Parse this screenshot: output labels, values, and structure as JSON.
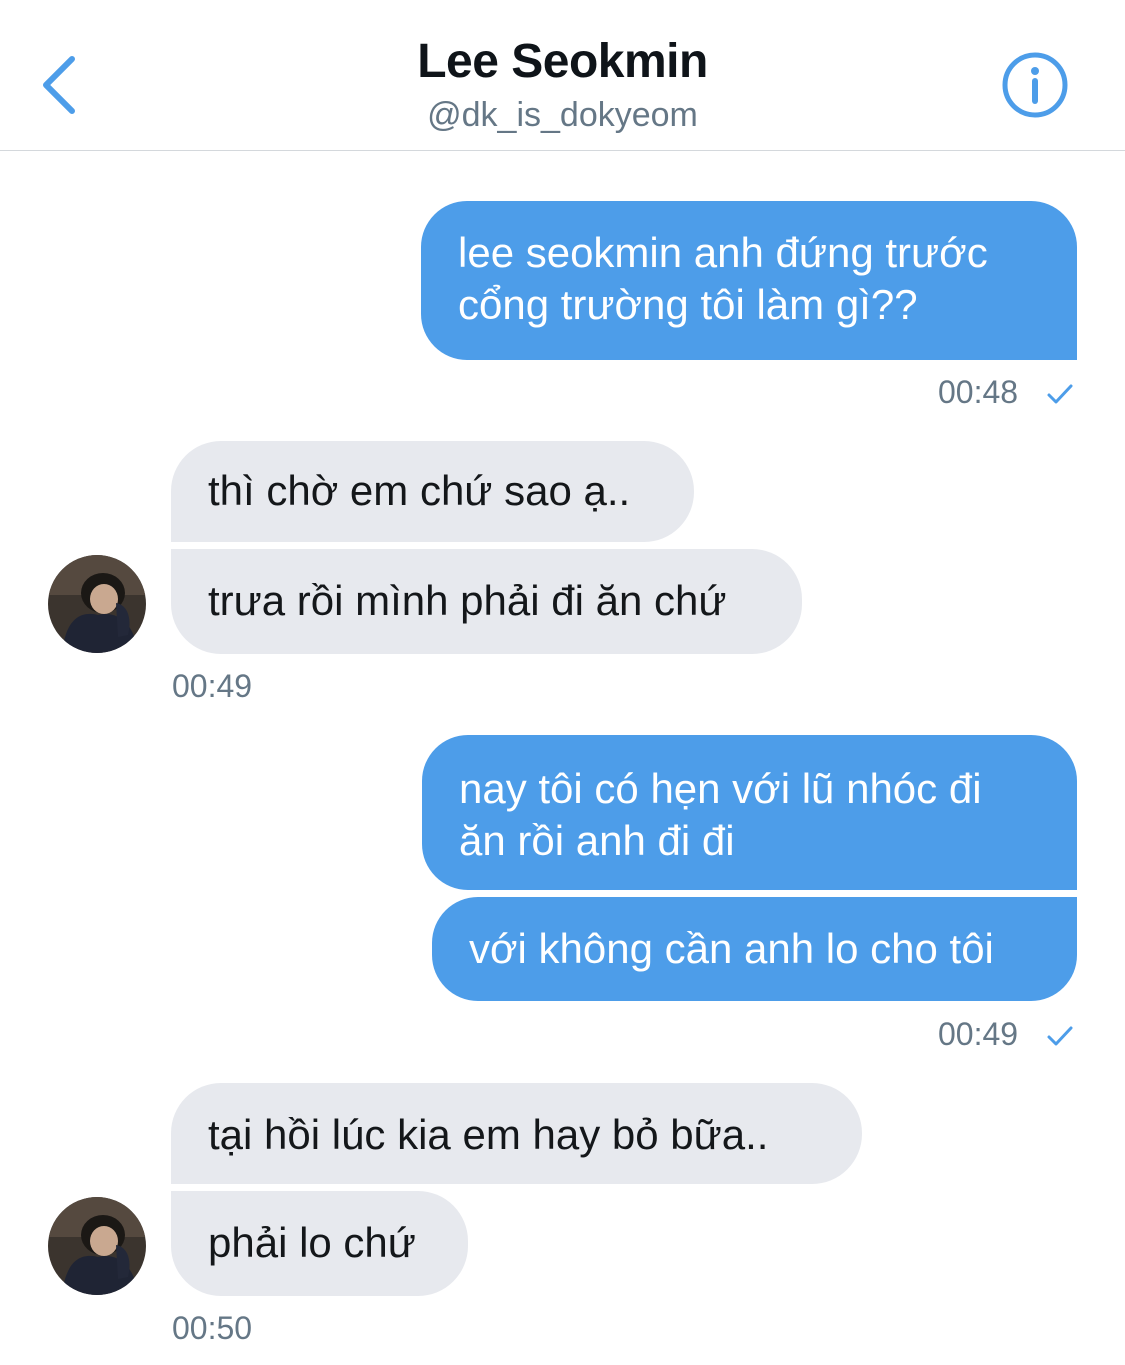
{
  "header": {
    "title": "Lee Seokmin",
    "handle": "@dk_is_dokyeom",
    "back_icon": "chevron-left-icon",
    "info_icon": "info-icon"
  },
  "colors": {
    "accent": "#4d9de9",
    "received_bubble": "#e7e9ee",
    "meta_text": "#657786"
  },
  "messages": [
    {
      "from": "me",
      "lines": [
        "lee seokmin anh đứng trước",
        "cổng trường tôi làm gì??"
      ]
    },
    {
      "from": "me",
      "time": "00:48",
      "status": "sent-check-icon"
    },
    {
      "from": "them",
      "text": "thì chờ em chứ sao ạ.."
    },
    {
      "from": "them",
      "text": "trưa rồi mình phải đi ăn chứ"
    },
    {
      "from": "them",
      "time": "00:49"
    },
    {
      "from": "me",
      "lines": [
        "nay tôi có hẹn với lũ nhóc đi",
        "ăn rồi anh đi đi"
      ]
    },
    {
      "from": "me",
      "text": "với không cần anh lo cho tôi"
    },
    {
      "from": "me",
      "time": "00:49",
      "status": "sent-check-icon"
    },
    {
      "from": "them",
      "text": "tại hồi lúc kia em hay bỏ bữa.."
    },
    {
      "from": "them",
      "text": "phải lo chứ"
    },
    {
      "from": "them",
      "time": "00:50"
    }
  ]
}
